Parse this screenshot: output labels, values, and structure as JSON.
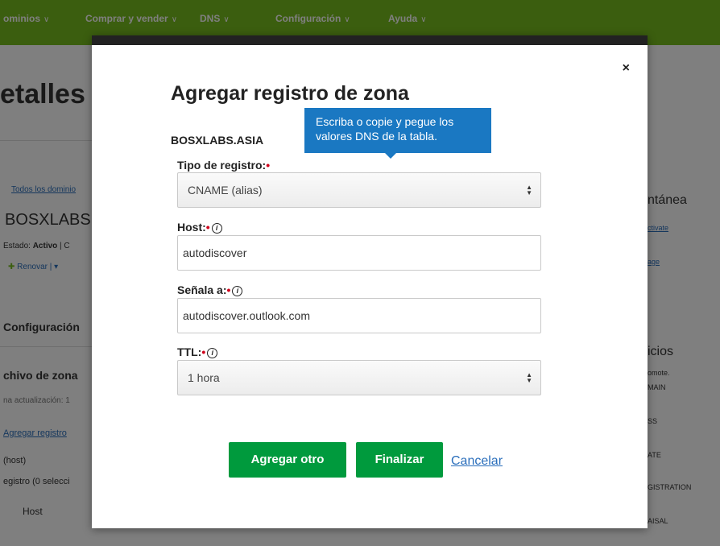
{
  "background": {
    "nav": [
      "ominios",
      "Comprar y vender",
      "DNS",
      "Configuración",
      "Ayuda"
    ],
    "page_heading": "etalles",
    "breadcrumb": "Todos los dominio",
    "domain_name": "BOSXLABS",
    "status_label": "Estado:",
    "status_value": "Activo",
    "status_sep": "| C",
    "renew_button": "Renovar",
    "tab_config": "Configuración",
    "zone_file": "chivo de zona",
    "last_update": "na actualización: 1",
    "add_record_link": "Agregar registro",
    "host_col": "(host)",
    "records_selected": "egistro (0 selecci",
    "host_header": "Host",
    "right_snapshot": "ntánea",
    "right_activate": "ctivate",
    "right_age": "age",
    "right_services": "icios",
    "right_promote": "omote.",
    "right_main": "MAIN",
    "right_ss": "SS",
    "right_ate": "ATE",
    "right_registration": "GISTRATION",
    "right_appraisal": "AISAL"
  },
  "modal": {
    "close": "×",
    "title": "Agregar registro de zona",
    "domain": "BOSXLABS.ASIA",
    "tooltip": "Escriba o copie y pegue los valores DNS de la tabla.",
    "record_type_label": "Tipo de registro:",
    "record_type_value": "CNAME (alias)",
    "host_label": "Host:",
    "host_value": "autodiscover",
    "points_to_label": "Señala a:",
    "points_to_value": "autodiscover.outlook.com",
    "ttl_label": "TTL:",
    "ttl_value": "1 hora",
    "required_mark": "•",
    "info_glyph": "i",
    "add_another": "Agregar otro",
    "finish": "Finalizar",
    "cancel": "Cancelar"
  }
}
